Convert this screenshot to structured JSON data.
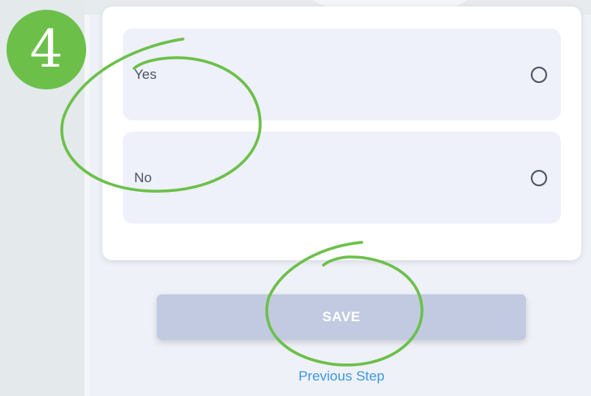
{
  "step_badge": {
    "number": "4",
    "color": "#6cc04a"
  },
  "options": [
    {
      "label": "Yes"
    },
    {
      "label": "No"
    }
  ],
  "save_button": {
    "label": "SAVE"
  },
  "previous_step": {
    "label": "Previous Step"
  },
  "colors": {
    "annotation": "#6cc04a",
    "save_button_bg": "#c1cae0",
    "link": "#3b97e3",
    "option_bg": "#eef1f9"
  }
}
